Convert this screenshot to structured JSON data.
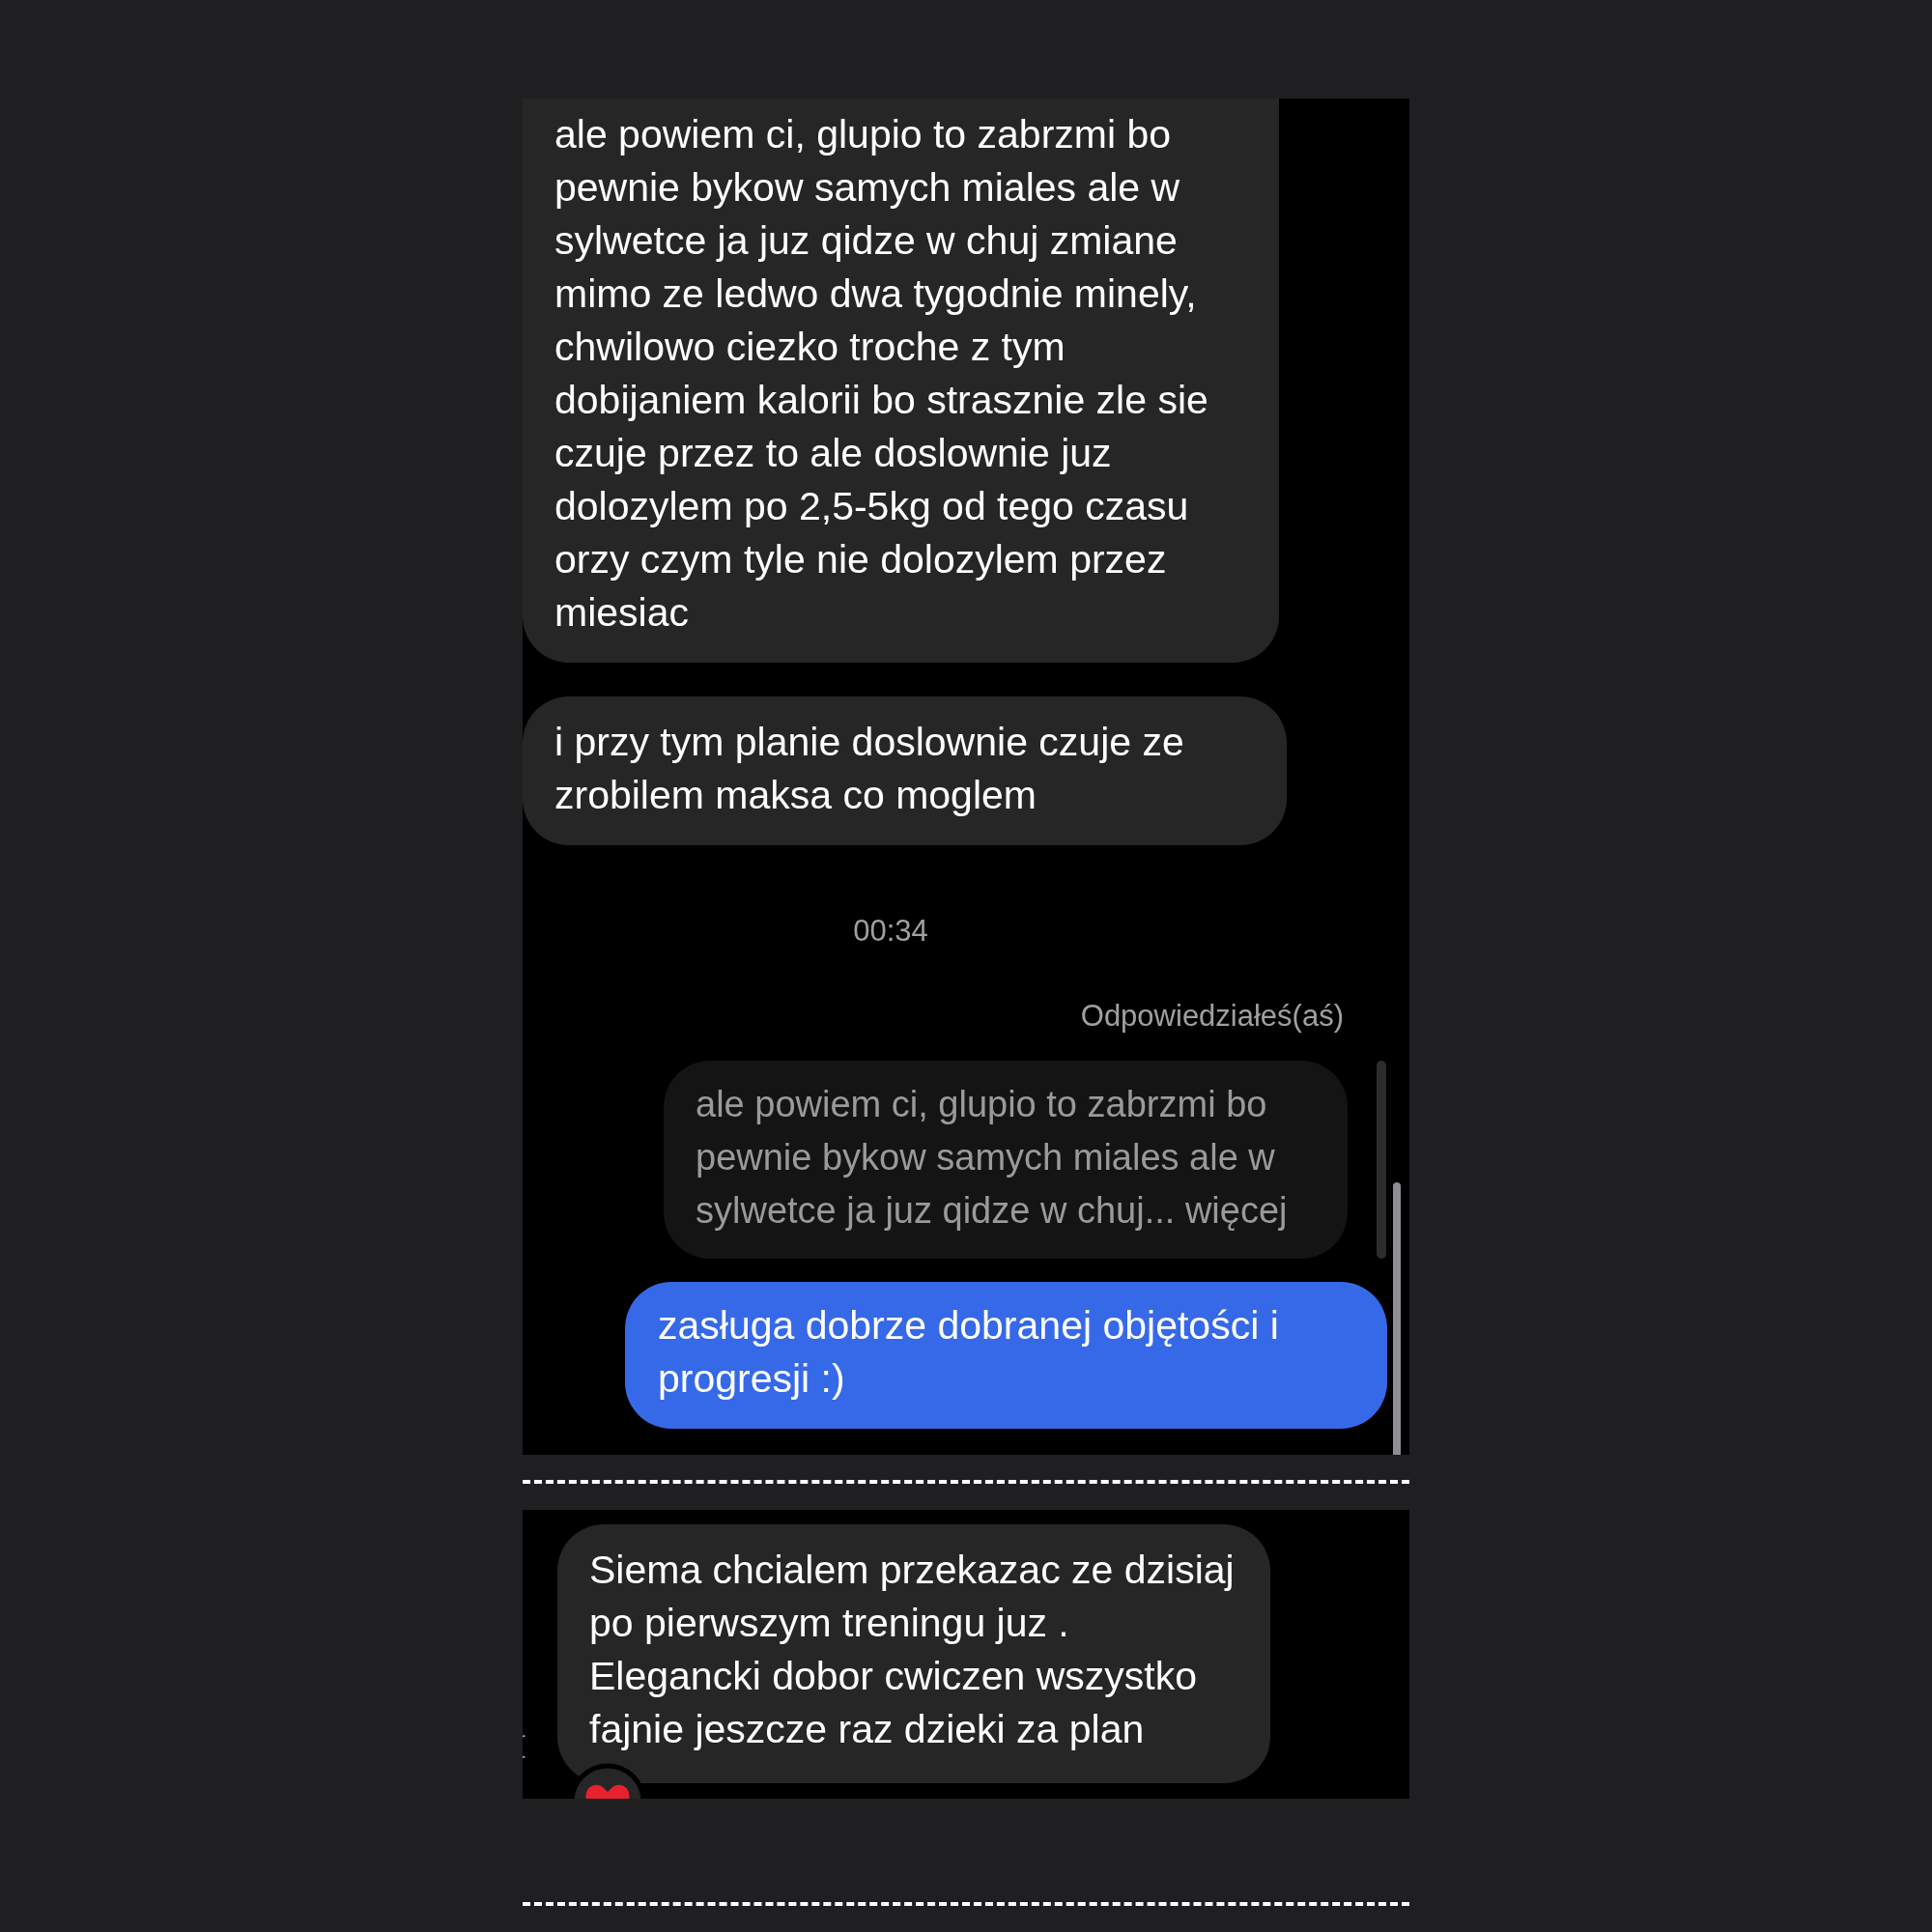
{
  "sections": [
    {
      "messages": [
        {
          "kind": "incoming",
          "text": "ale powiem ci, glupio to zabrzmi bo pewnie bykow samych miales ale w sylwetce ja juz qidze w chuj zmiane mimo ze ledwo dwa tygodnie minely, chwilowo ciezko troche z tym dobijaniem kalorii bo strasznie zle sie czuje przez to ale doslownie juz dolozylem po 2,5-5kg od tego czasu orzy czym tyle nie dolozylem przez miesiac"
        },
        {
          "kind": "incoming",
          "text": "i przy tym planie doslownie czuje ze zrobilem maksa co moglem"
        },
        {
          "kind": "timestamp",
          "text": "00:34"
        },
        {
          "kind": "reply_label",
          "text": "Odpowiedziałeś(aś)"
        },
        {
          "kind": "quoted",
          "text": "ale powiem ci, glupio to zabrzmi bo pewnie bykow samych miales ale w sylwetce ja juz qidze w chuj...",
          "more": "więcej"
        },
        {
          "kind": "outgoing",
          "text": "zasługa dobrze dobranej objętości i progresji :)"
        }
      ]
    },
    {
      "messages": [
        {
          "kind": "incoming",
          "text": "Siema chcialem przekazac ze dzisiaj po pierwszym treningu juz . Elegancki dobor cwiczen wszystko fajnie jeszcze raz dzieki za plan",
          "reacted": true
        }
      ]
    }
  ]
}
